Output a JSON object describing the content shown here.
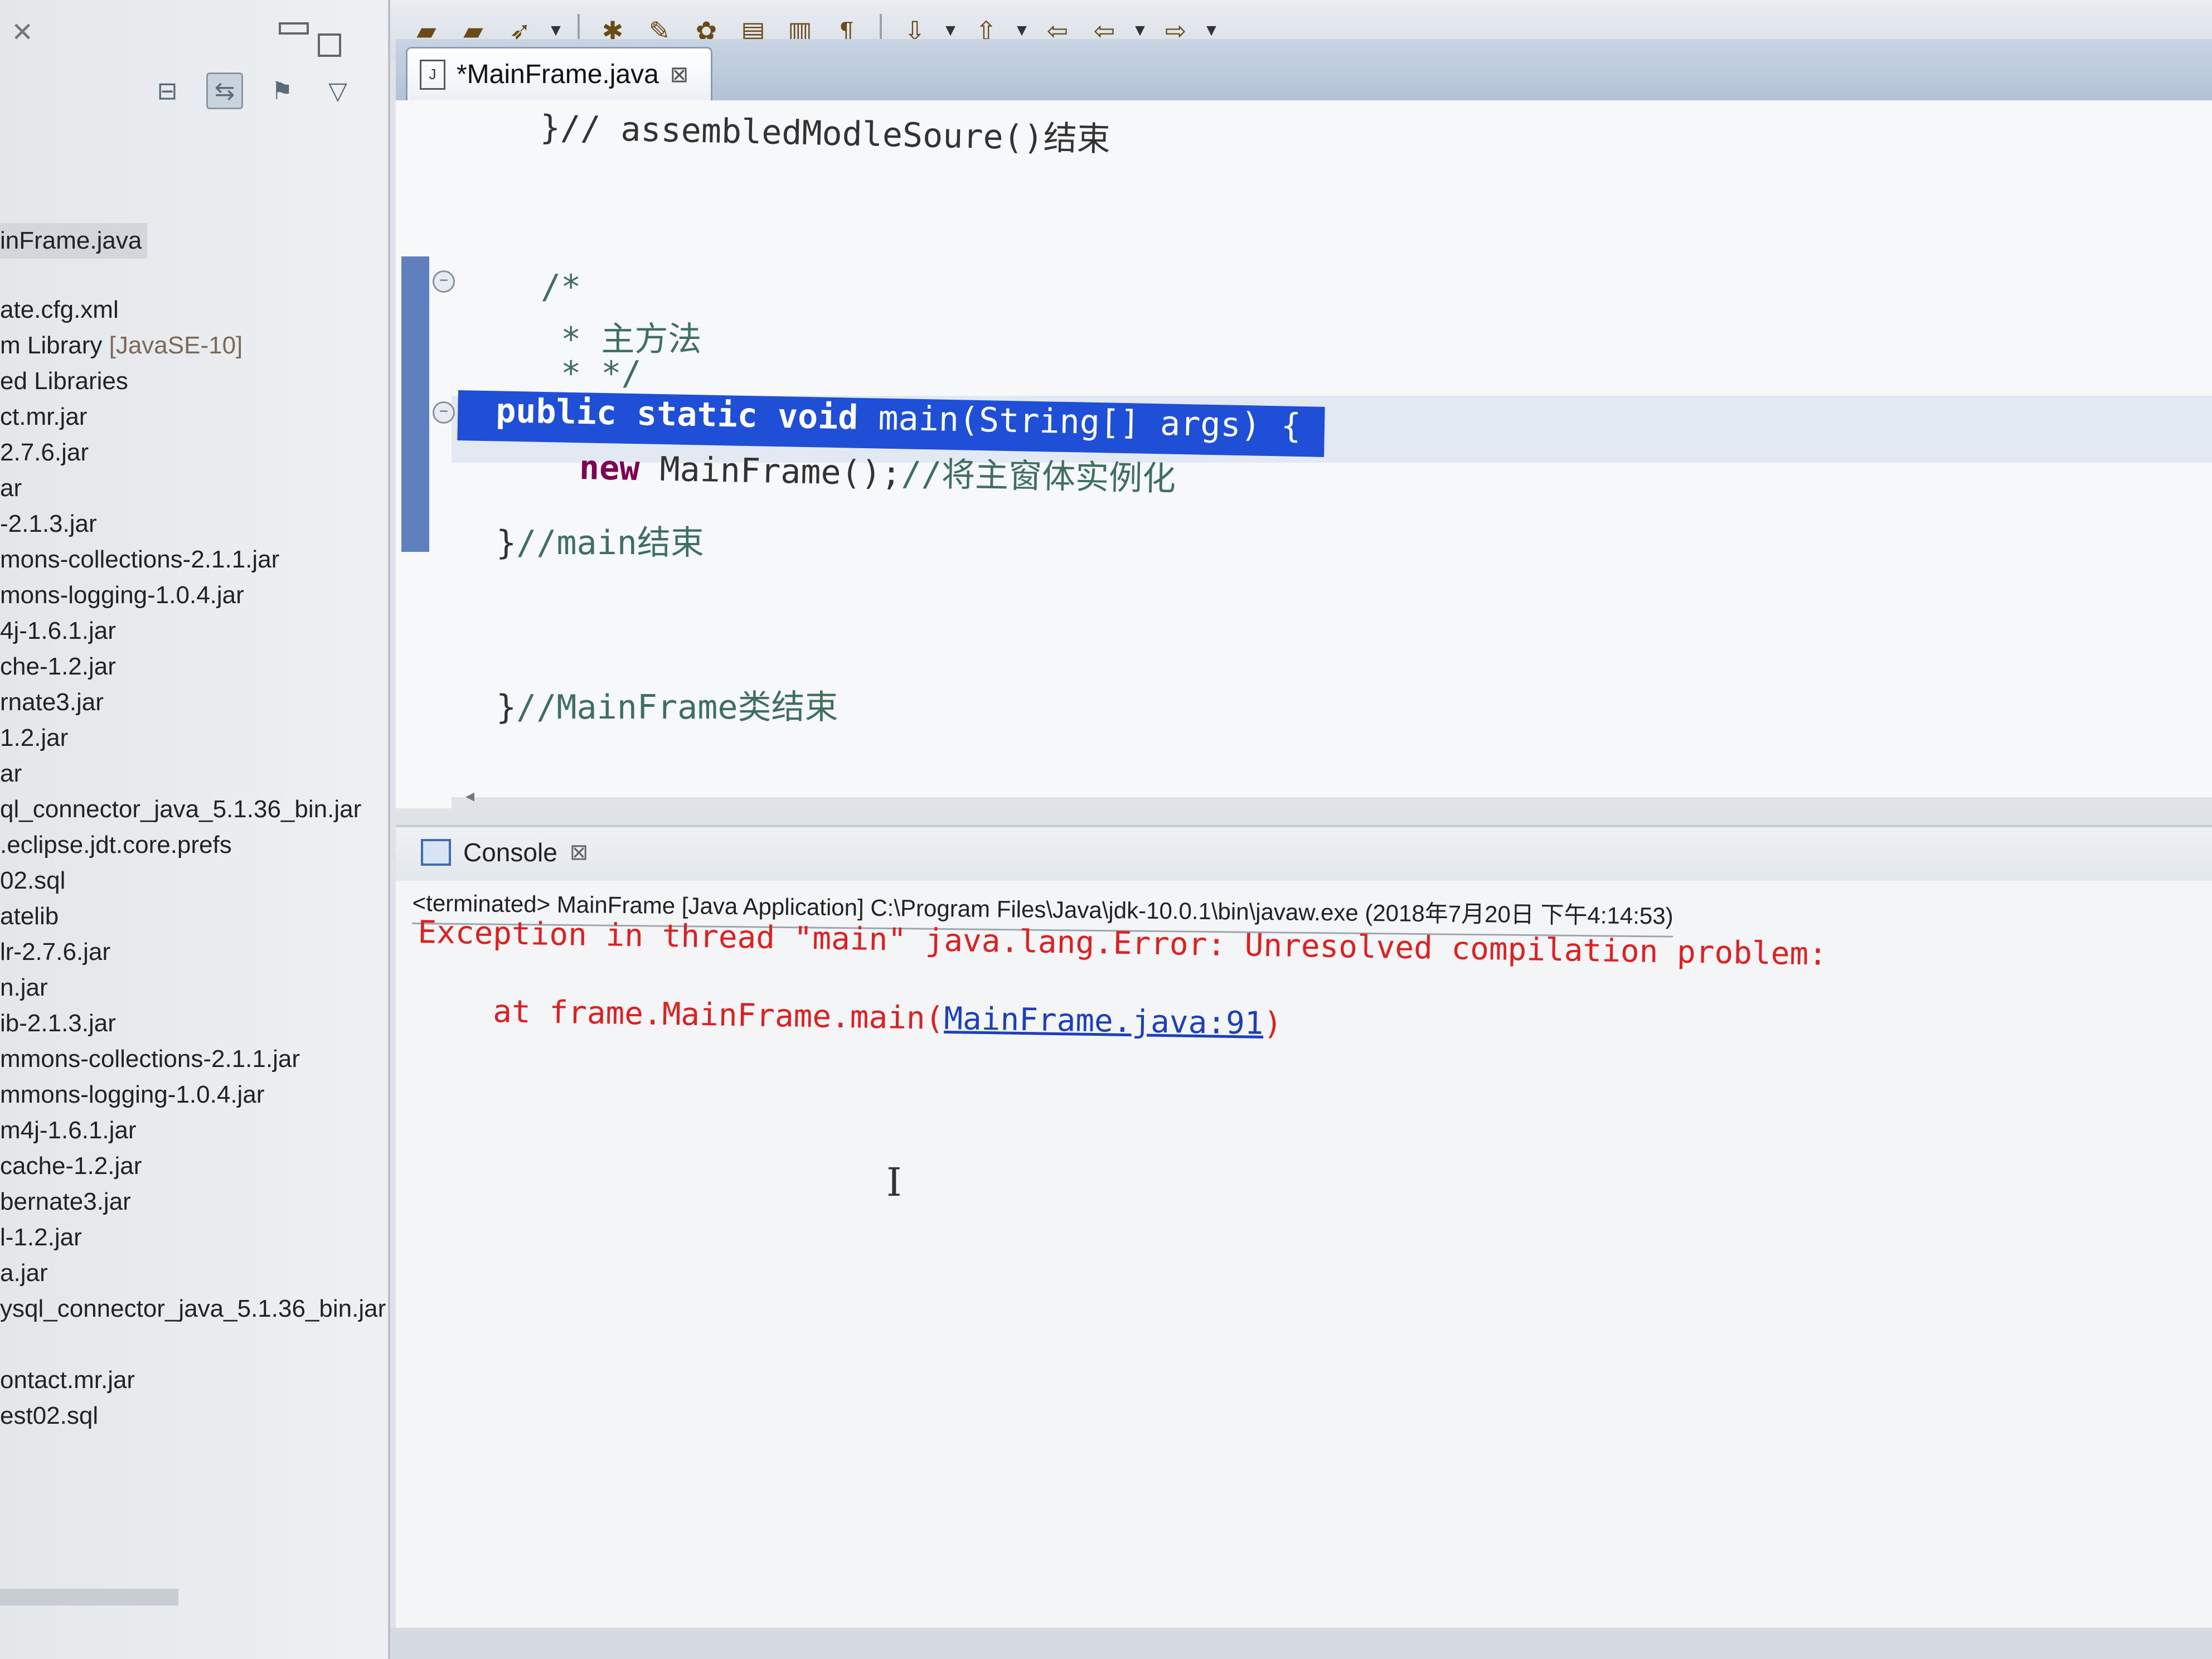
{
  "toolbar": {
    "icons": [
      "open-folder-icon",
      "open-folder-icon",
      "rocket-icon",
      "debug-icon",
      "brush-icon",
      "paint-icon",
      "page-icon",
      "panel-icon",
      "paragraph-icon",
      "next-annotation-icon",
      "previous-annotation-icon",
      "back-arrow-icon",
      "back-icon",
      "forward-icon"
    ]
  },
  "explorer": {
    "items": [
      {
        "label": "inFrame.java",
        "selected": true
      },
      {
        "label": "ate.cfg.xml"
      },
      {
        "label": "m Library ",
        "suffix": "[JavaSE-10]"
      },
      {
        "label": "ed Libraries"
      },
      {
        "label": "ct.mr.jar"
      },
      {
        "label": "2.7.6.jar"
      },
      {
        "label": "ar"
      },
      {
        "label": "-2.1.3.jar"
      },
      {
        "label": "mons-collections-2.1.1.jar"
      },
      {
        "label": "mons-logging-1.0.4.jar"
      },
      {
        "label": "4j-1.6.1.jar"
      },
      {
        "label": "che-1.2.jar"
      },
      {
        "label": "rnate3.jar"
      },
      {
        "label": "1.2.jar"
      },
      {
        "label": "ar"
      },
      {
        "label": "ql_connector_java_5.1.36_bin.jar"
      },
      {
        "label": ".eclipse.jdt.core.prefs"
      },
      {
        "label": "02.sql"
      },
      {
        "label": "atelib"
      },
      {
        "label": "lr-2.7.6.jar"
      },
      {
        "label": "n.jar"
      },
      {
        "label": "ib-2.1.3.jar"
      },
      {
        "label": "mmons-collections-2.1.1.jar"
      },
      {
        "label": "mmons-logging-1.0.4.jar"
      },
      {
        "label": "m4j-1.6.1.jar"
      },
      {
        "label": "cache-1.2.jar"
      },
      {
        "label": "bernate3.jar"
      },
      {
        "label": "l-1.2.jar"
      },
      {
        "label": "a.jar"
      },
      {
        "label": "ysql_connector_java_5.1.36_bin.jar"
      },
      {
        "label": ""
      },
      {
        "label": "ontact.mr.jar"
      },
      {
        "label": "est02.sql"
      }
    ]
  },
  "editor": {
    "tab_title": "*MainFrame.java",
    "lines": {
      "l1": "}// assembledModleSoure()结束",
      "l2": "/*",
      "l3": " * 主方法",
      "l4": " * */",
      "l5_kw": "public static void ",
      "l5_rest": "main(String[] args) {",
      "l6_kw": "new ",
      "l6_code": "MainFrame();",
      "l6_comment": "//将主窗体实例化",
      "l7_brace": "}",
      "l7_comment": "//main结束",
      "l8_brace": "}",
      "l8_comment": "//MainFrame类结束"
    }
  },
  "console": {
    "title": "Console",
    "status": "<terminated> MainFrame [Java Application] C:\\Program Files\\Java\\jdk-10.0.1\\bin\\javaw.exe (2018年7月20日 下午4:14:53)",
    "error_line": "Exception in thread \"main\" java.lang.Error: Unresolved compilation problem:",
    "trace_prefix": "    at frame.MainFrame.main(",
    "trace_link": "MainFrame.java:91",
    "trace_suffix": ")"
  },
  "colors": {
    "selection": "#1e4fd6",
    "error_text": "#e02020",
    "link": "#1c3fbf",
    "keyword": "#7f0055",
    "comment": "#3f6f5f"
  }
}
